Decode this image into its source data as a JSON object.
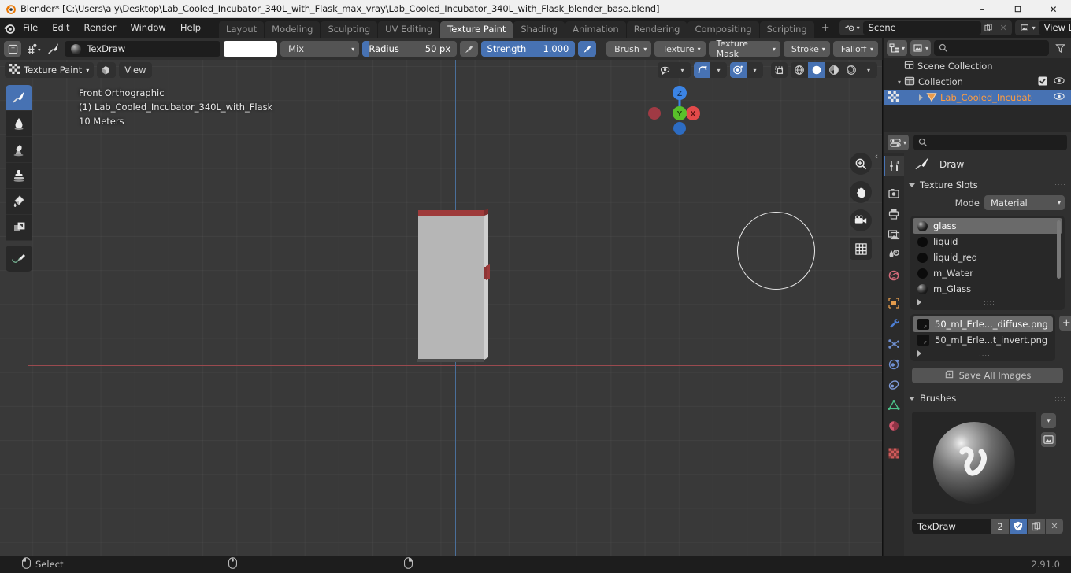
{
  "window": {
    "title": "Blender* [C:\\Users\\a y\\Desktop\\Lab_Cooled_Incubator_340L_with_Flask_max_vray\\Lab_Cooled_Incubator_340L_with_Flask_blender_base.blend]",
    "minimize": "–",
    "maximize": "❐",
    "close": "✕"
  },
  "menubar": {
    "items": [
      {
        "label": "File"
      },
      {
        "label": "Edit"
      },
      {
        "label": "Render"
      },
      {
        "label": "Window"
      },
      {
        "label": "Help"
      }
    ]
  },
  "workspaces": {
    "tabs": [
      {
        "label": "Layout",
        "active": false
      },
      {
        "label": "Modeling",
        "active": false
      },
      {
        "label": "Sculpting",
        "active": false
      },
      {
        "label": "UV Editing",
        "active": false
      },
      {
        "label": "Texture Paint",
        "active": true
      },
      {
        "label": "Shading",
        "active": false
      },
      {
        "label": "Animation",
        "active": false
      },
      {
        "label": "Rendering",
        "active": false
      },
      {
        "label": "Compositing",
        "active": false
      },
      {
        "label": "Scripting",
        "active": false
      }
    ],
    "add_label": "+"
  },
  "topbar_right": {
    "scene_name": "Scene",
    "view_layer_name": "View Layer"
  },
  "tool_settings": {
    "brush_name": "TexDraw",
    "blend_mode": "Mix",
    "color_hex": "#ffffff",
    "radius_label": "Radius",
    "radius_value": "50 px",
    "strength_label": "Strength",
    "strength_value": "1.000",
    "strength_fill_pct": 100,
    "brush_menu": "Brush",
    "texture_menu": "Texture",
    "texture_mask_menu": "Texture Mask",
    "stroke_menu": "Stroke",
    "falloff_menu": "Falloff"
  },
  "viewport": {
    "mode": "Texture Paint",
    "view_menu": "View",
    "overlay_text": {
      "line1": "Front Orthographic",
      "line2": "(1) Lab_Cooled_Incubator_340L_with_Flask",
      "line3": "10 Meters"
    },
    "gizmo": {
      "z_label": "Z",
      "y_label": "Y",
      "x_label": "X",
      "z_color": "#3b84e5",
      "y_color": "#59c12a",
      "x_color": "#e34a4a"
    },
    "tools": [
      {
        "name": "draw-tool",
        "active": true
      },
      {
        "name": "soften-tool",
        "active": false
      },
      {
        "name": "smear-tool",
        "active": false
      },
      {
        "name": "clone-tool",
        "active": false
      },
      {
        "name": "fill-tool",
        "active": false
      },
      {
        "name": "mask-tool",
        "active": false
      },
      {
        "name": "annotate-tool",
        "active": false
      }
    ],
    "shading_modes": [
      {
        "name": "wireframe",
        "active": false
      },
      {
        "name": "solid",
        "active": true
      },
      {
        "name": "material-preview",
        "active": false
      },
      {
        "name": "rendered",
        "active": false
      }
    ]
  },
  "outliner": {
    "rows": [
      {
        "label": "Scene Collection",
        "indent": 0,
        "selected": false,
        "icon": "scene-collection-icon",
        "has_arrow": false,
        "checkbox": false,
        "eye": false
      },
      {
        "label": "Collection",
        "indent": 1,
        "selected": false,
        "icon": "collection-icon",
        "has_arrow": true,
        "checkbox": true,
        "eye": true
      },
      {
        "label": "Lab_Cooled_Incubato",
        "indent": 2,
        "selected": true,
        "icon": "mesh-object-icon",
        "has_arrow": true,
        "checkbox": false,
        "eye": true
      }
    ]
  },
  "properties": {
    "active_tool_title": "Draw",
    "tabs": [
      {
        "name": "tool-tab",
        "active": true,
        "color": "#d8d8d8"
      },
      {
        "name": "render-tab",
        "active": false,
        "color": "#cacaca"
      },
      {
        "name": "output-tab",
        "active": false,
        "color": "#cacaca"
      },
      {
        "name": "view-layer-tab",
        "active": false,
        "color": "#cacaca"
      },
      {
        "name": "scene-tab",
        "active": false,
        "color": "#cacaca"
      },
      {
        "name": "world-tab",
        "active": false,
        "color": "#d46a7a"
      },
      {
        "name": "object-tab",
        "active": false,
        "color": "#e49c4c"
      },
      {
        "name": "modifier-tab",
        "active": false,
        "color": "#4d7fd4"
      },
      {
        "name": "particles-tab",
        "active": false,
        "color": "#6f8fd0"
      },
      {
        "name": "physics-tab",
        "active": false,
        "color": "#6f8fd0"
      },
      {
        "name": "constraints-tab",
        "active": false,
        "color": "#7f9ad8"
      },
      {
        "name": "data-tab",
        "active": false,
        "color": "#4cc48a"
      },
      {
        "name": "material-tab",
        "active": false,
        "color": "#d0566c"
      },
      {
        "name": "texture-tab",
        "active": false,
        "color": "#d05a5a"
      }
    ],
    "texture_slots": {
      "panel_title": "Texture Slots",
      "mode_label": "Mode",
      "mode_value": "Material",
      "materials": [
        {
          "label": "glass",
          "selected": true,
          "preview": "glassy"
        },
        {
          "label": "liquid",
          "selected": false,
          "preview": "dark"
        },
        {
          "label": "liquid_red",
          "selected": false,
          "preview": "dark"
        },
        {
          "label": "m_Water",
          "selected": false,
          "preview": "dark"
        },
        {
          "label": "m_Glass",
          "selected": false,
          "preview": "glassy"
        }
      ],
      "images": [
        {
          "label": "50_ml_Erle..._diffuse.png",
          "selected": true
        },
        {
          "label": "50_ml_Erle...t_invert.png",
          "selected": false
        }
      ],
      "add_label": "+",
      "save_all_images": "Save All Images"
    },
    "brushes": {
      "panel_title": "Brushes",
      "active_brush": "TexDraw",
      "users_count": "2",
      "fake_user_on": true
    }
  },
  "statusbar": {
    "select_label": "Select",
    "version": "2.91.0"
  }
}
